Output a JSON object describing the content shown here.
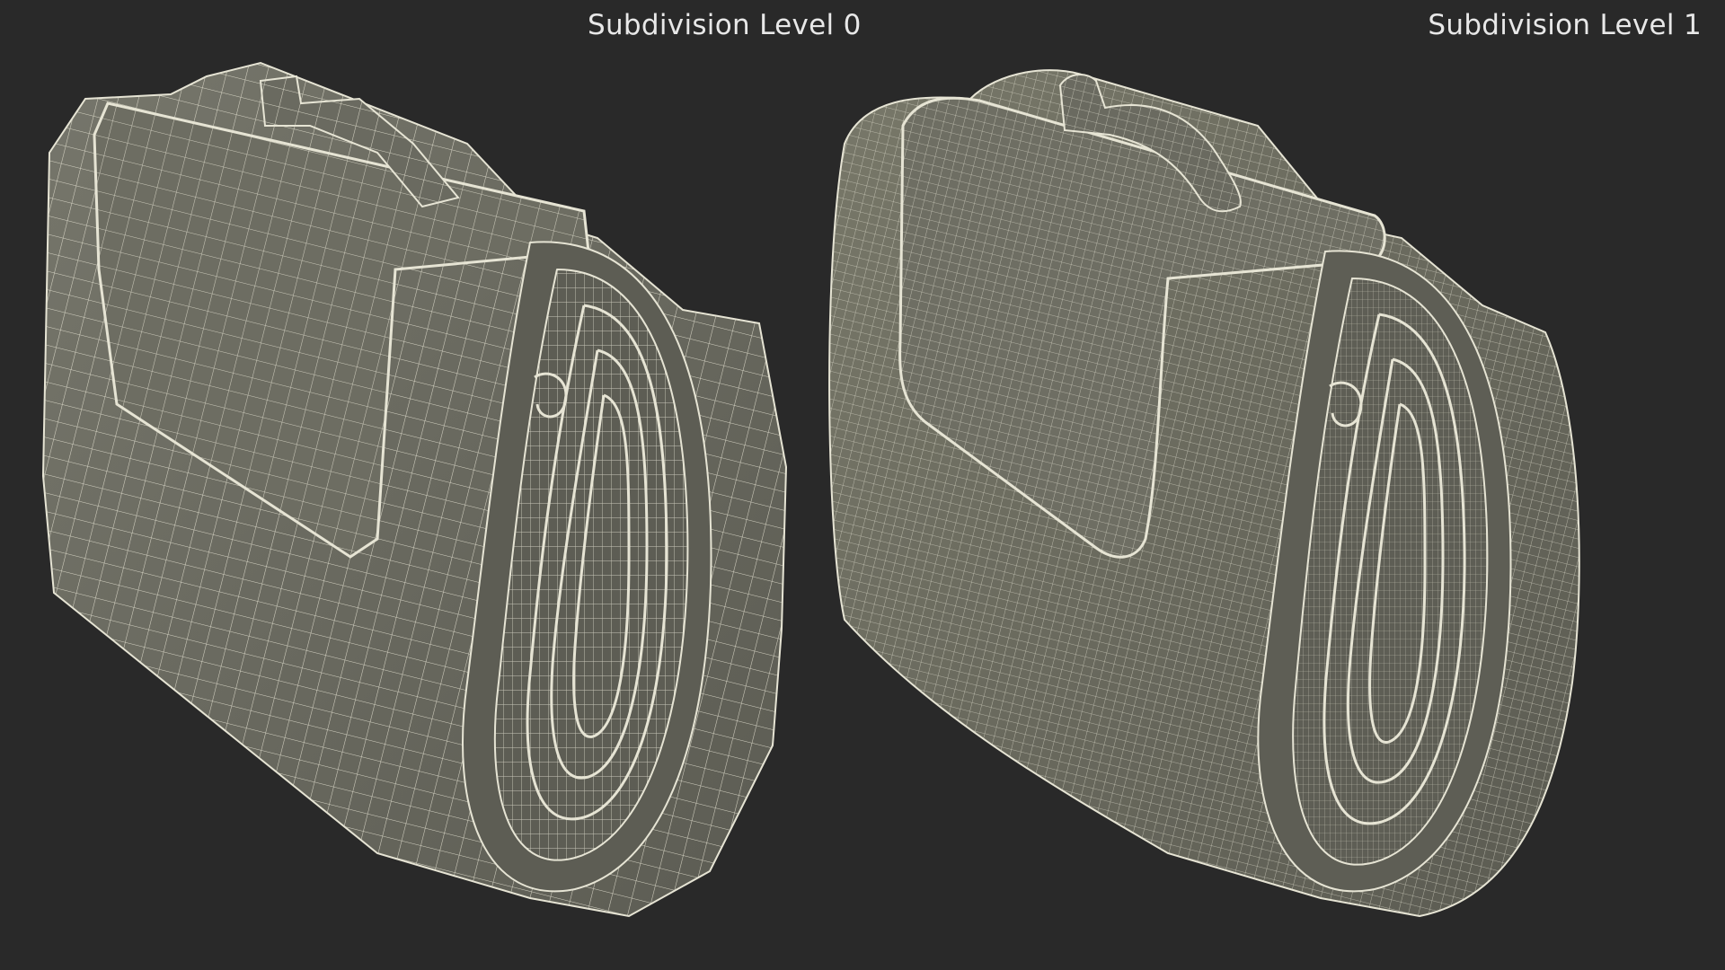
{
  "labels": {
    "level_0": "Subdivision Level 0",
    "level_1": "Subdivision Level 1"
  },
  "colors": {
    "background": "#292929",
    "mesh_fill": "#6f6f64",
    "mesh_fill_shadow": "#55554c",
    "wire": "#e6e4d4",
    "label": "#e8e8e8"
  },
  "renders": [
    {
      "subject": "rolled-picnic-blanket-wireframe",
      "density": "low"
    },
    {
      "subject": "rolled-picnic-blanket-wireframe",
      "density": "high"
    }
  ]
}
